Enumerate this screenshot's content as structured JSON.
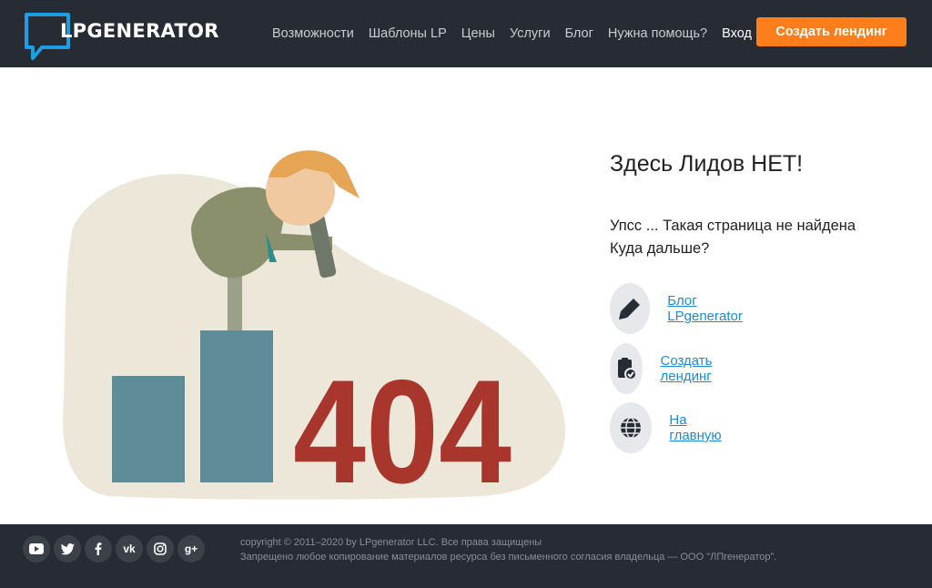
{
  "header": {
    "logo_text": "LPGENERATOR",
    "nav": [
      "Возможности",
      "Шаблоны LP",
      "Цены",
      "Услуги",
      "Блог",
      "Нужна помощь?"
    ],
    "login": "Вход",
    "cta": "Создать лендинг"
  },
  "illustration": {
    "code": "404"
  },
  "main": {
    "title": "Здесь Лидов НЕТ!",
    "line1": "Упсс ... Такая страница не найдена",
    "line2": "Куда дальше?",
    "links": [
      {
        "label": "Блог LPgenerator",
        "icon": "pencil-icon"
      },
      {
        "label": "Создать лендинг",
        "icon": "clipboard-check-icon"
      },
      {
        "label": "На главную",
        "icon": "globe-icon"
      }
    ]
  },
  "footer": {
    "social": [
      "youtube-icon",
      "twitter-icon",
      "facebook-icon",
      "vk-icon",
      "instagram-icon",
      "google-plus-icon"
    ],
    "vk_text": "vk",
    "gplus_text": "g+",
    "copyright": "copyright © 2011–2020 by LPgenerator LLC. Все права защищены",
    "notice": "Запрещено любое копирование материалов ресурса без письменного согласия владельца — ООО \"ЛПгенератор\"."
  },
  "colors": {
    "header_bg": "#272b33",
    "accent": "#ff7e1c",
    "link": "#1e8ad6",
    "icon_bg": "#e6e8ec",
    "bar": "#5e8d99",
    "code": "#a8362c"
  }
}
